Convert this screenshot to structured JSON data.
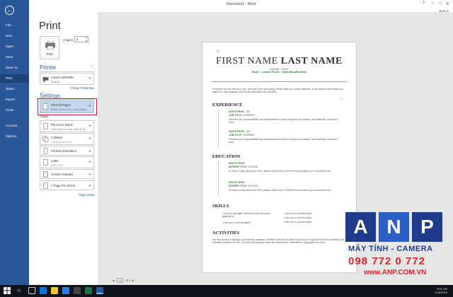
{
  "window": {
    "title": "Document1 - Word",
    "user": "Sign in",
    "minimize": "–",
    "maximize": "□",
    "close": "✕"
  },
  "nav": {
    "back_glyph": "←",
    "items": [
      "Info",
      "New",
      "Open",
      "Save",
      "Save As",
      "Print",
      "Share",
      "Export",
      "Close",
      "Account",
      "Options"
    ],
    "active": "Print"
  },
  "print": {
    "title": "Print",
    "print_button": "Print",
    "copies_label": "Copies:",
    "copies_value": "1"
  },
  "printer": {
    "heading": "Printer",
    "name": "Canon LBP2900",
    "status": "Ready",
    "properties_link": "Printer Properties"
  },
  "settings": {
    "heading": "Settings",
    "pages_label": "Pages:",
    "items": [
      {
        "title": "Print All Pages",
        "sub": "Entire document; odd pages..."
      },
      {
        "title": "Print One Sided",
        "sub": "Only print on one side of th..."
      },
      {
        "title": "Collated",
        "sub": "1,2,3    1,2,3    1,2,3"
      },
      {
        "title": "Portrait Orientation",
        "sub": ""
      },
      {
        "title": "Letter",
        "sub": "8.5\" x 11\""
      },
      {
        "title": "Custom Margins",
        "sub": ""
      },
      {
        "title": "1 Page Per Sheet",
        "sub": ""
      }
    ],
    "page_setup_link": "Page Setup"
  },
  "pager": {
    "current": "1",
    "of_label": "of 1",
    "prev": "◄",
    "next": "►"
  },
  "resume": {
    "first_name": "FIRST NAME",
    "last_name": "LAST NAME",
    "address": "Address · Phone",
    "links": "Email · LinkedIn Profile · Twitter/Blog/Portfolio",
    "intro": "To replace the text with your own, just click it and start typing. Briefly state your career objective, or summarize what makes you stand out. Use language from the job description as keywords.",
    "experience": {
      "heading": "EXPERIENCE",
      "entries": [
        {
          "dates": "DATES FROM – TO",
          "title": "JOB TITLE",
          "org": ", COMPANY",
          "desc": "Describe your responsibilities and achievements in terms of impact and results. Use examples, but keep it short."
        },
        {
          "dates": "DATES FROM – TO",
          "title": "JOB TITLE",
          "org": ", COMPANY",
          "desc": "Describe your responsibilities and achievements in terms of impact and results. Use examples, but keep it short."
        }
      ]
    },
    "education": {
      "heading": "EDUCATION",
      "entries": [
        {
          "dates": "MONTH YEAR",
          "title": "DEGREE TITLE",
          "org": ", SCHOOL",
          "desc": "It's okay to brag about your GPA, awards, and honors. Feel free to summarize your coursework too."
        },
        {
          "dates": "MONTH YEAR",
          "title": "DEGREE TITLE",
          "org": ", SCHOOL",
          "desc": "It's okay to brag about your GPA, awards, and honors. Feel free to summarize your coursework too."
        }
      ]
    },
    "skills": {
      "heading": "SKILLS",
      "left": [
        "List your strengths relevant for the role you're applying for",
        "List one of your strengths"
      ],
      "right": [
        "List one of your strengths",
        "List one of your strengths",
        "List one of your strengths"
      ]
    },
    "activities": {
      "heading": "ACTIVITIES",
      "text": "Use this section to highlight your relevant passions, activities, and how you like to give back. It's good to include Leadership and volunteer experiences here. Or show off important extras like publications, certifications, languages and more."
    }
  },
  "watermark": {
    "letters": [
      "A",
      "N",
      "P"
    ],
    "line1": "MÁY TÍNH - CAMERA",
    "line2": "098 772 0 772",
    "line3": "www.ANP.COM.VN"
  },
  "taskbar": {
    "time": "5:51 PM",
    "date": "1/28/2019"
  },
  "colors": {
    "nav": "#2b579a",
    "accent": "#2b579a",
    "highlight": "#c5d7ef",
    "red_box": "#c8102e",
    "green": "#2e7d32"
  }
}
